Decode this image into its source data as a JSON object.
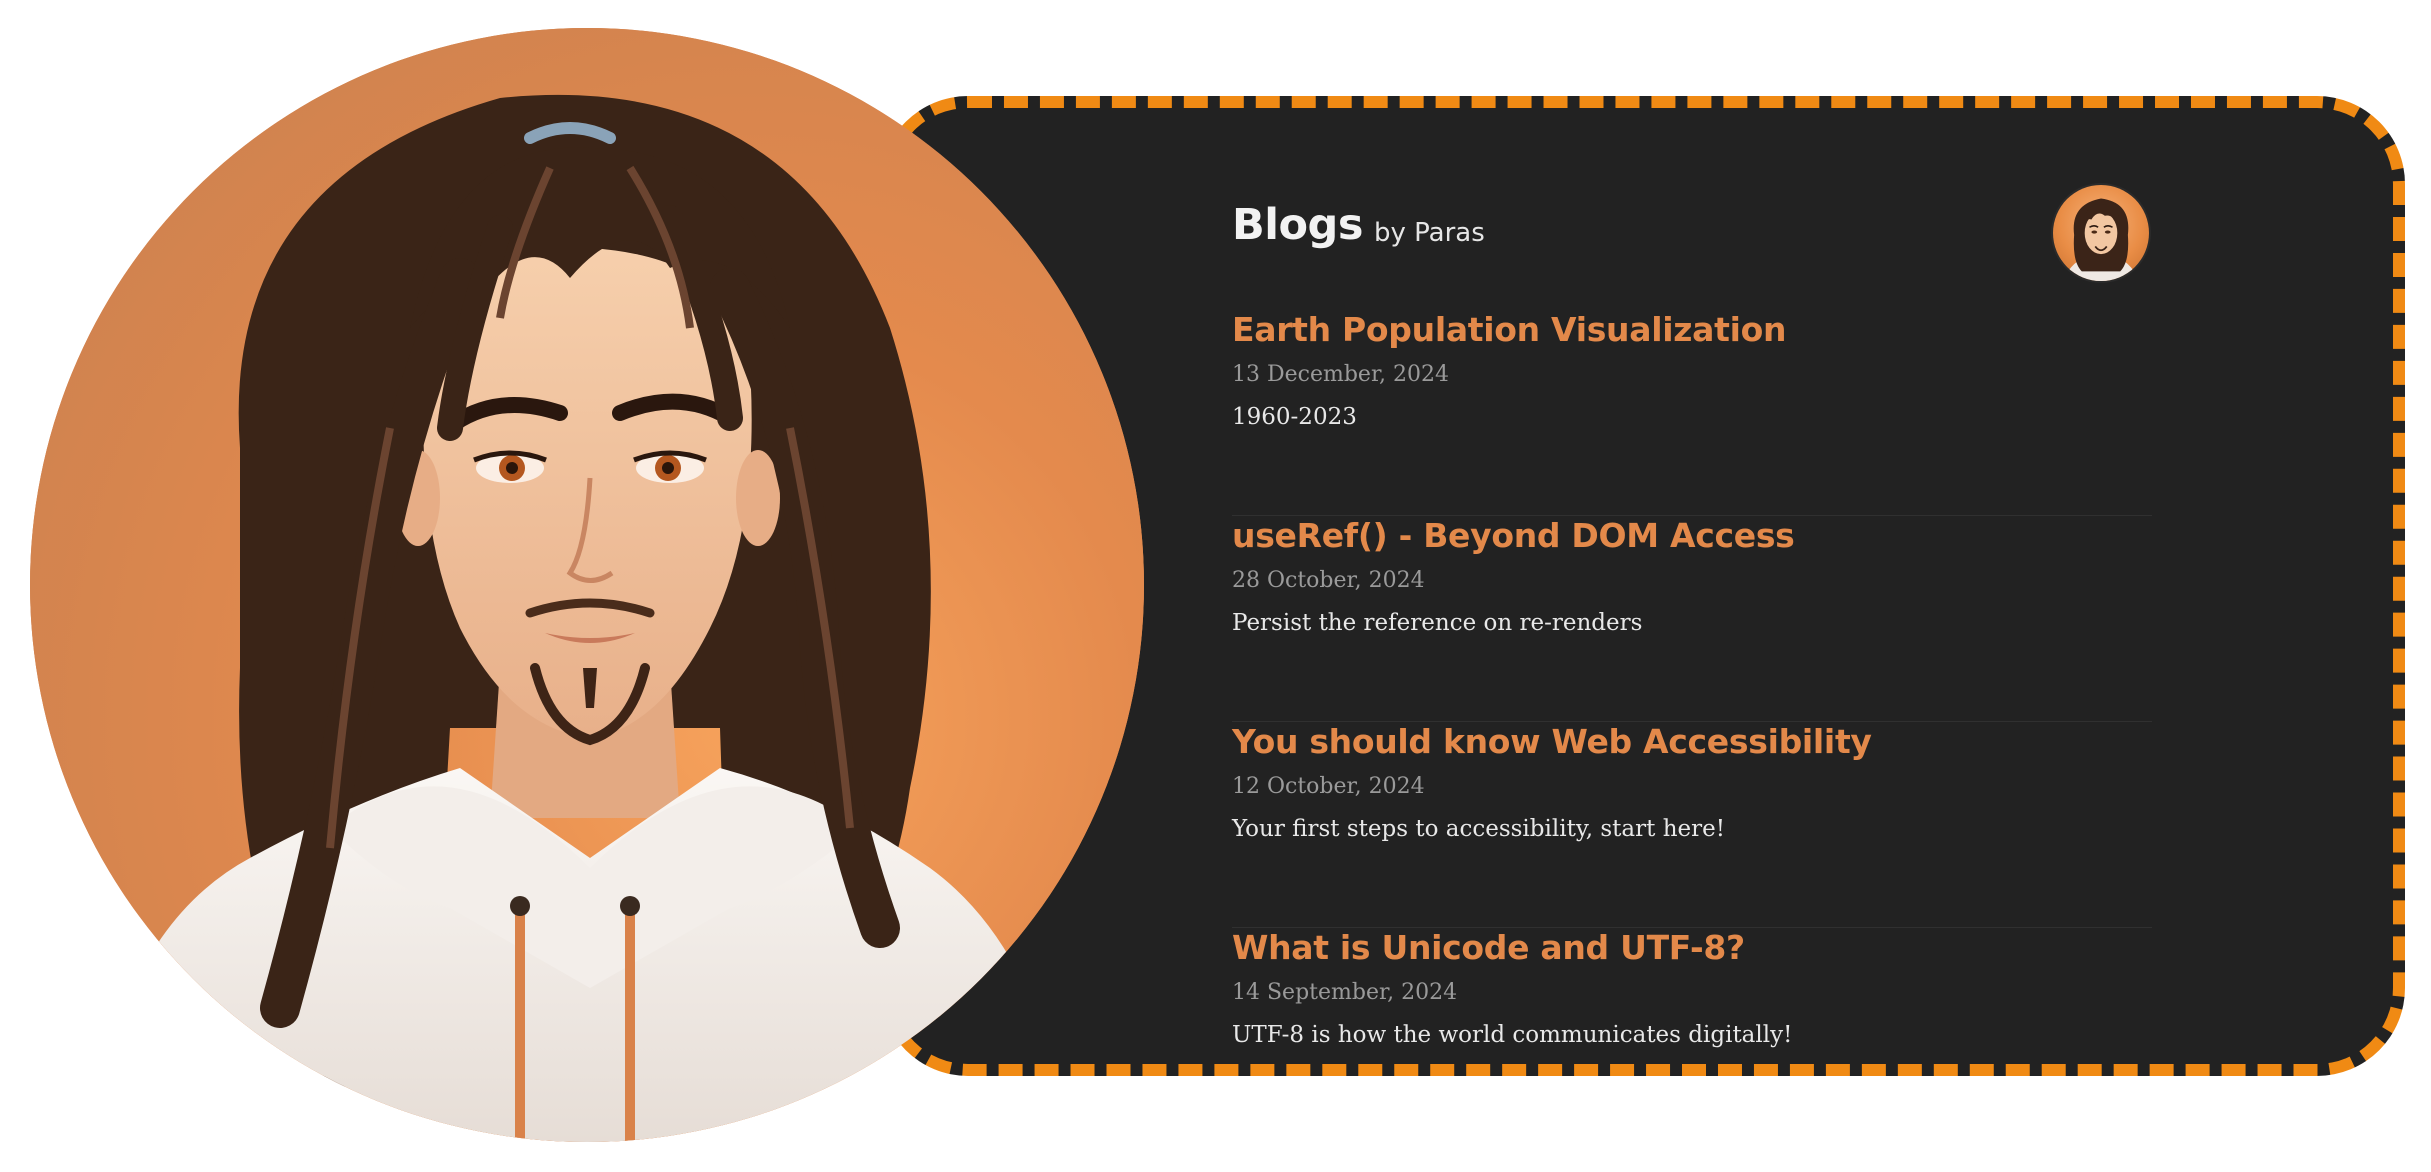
{
  "header": {
    "title": "Blogs",
    "byline": "by Paras"
  },
  "posts": [
    {
      "title": "Earth Population Visualization",
      "date": "13 December, 2024",
      "summary": "1960-2023"
    },
    {
      "title": "useRef() - Beyond DOM Access",
      "date": "28 October, 2024",
      "summary": "Persist the reference on re-renders"
    },
    {
      "title": "You should know Web Accessibility",
      "date": "12 October, 2024",
      "summary": "Your first steps to accessibility, start here!"
    },
    {
      "title": "What is Unicode and UTF-8?",
      "date": "14 September, 2024",
      "summary": "UTF-8 is how the world communicates digitally!"
    }
  ],
  "colors": {
    "accent": "#f08a14",
    "post_title": "#e3894a",
    "card_background": "#222222",
    "portrait_background": "#e8894a"
  },
  "icons": {
    "avatar": "portrait-illustration",
    "header_avatar": "avatar-icon"
  }
}
